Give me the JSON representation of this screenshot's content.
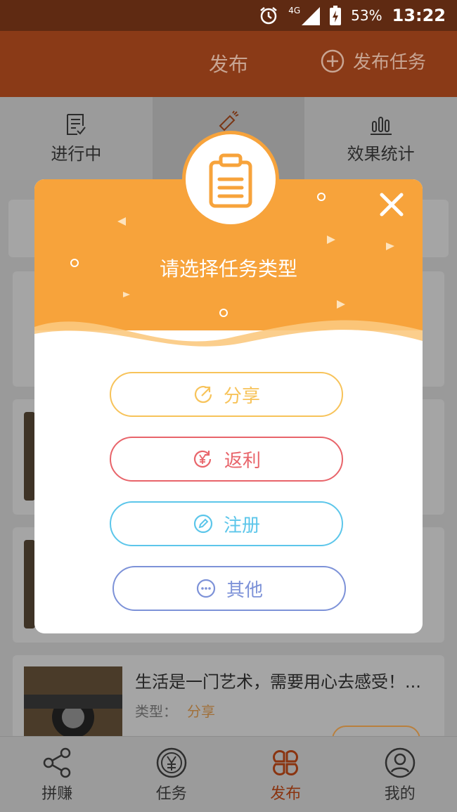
{
  "status": {
    "network": "4G",
    "battery": "53%",
    "time": "13:22"
  },
  "header": {
    "title": "发布",
    "publish_label": "发布任务"
  },
  "tabs": [
    {
      "label": "进行中"
    },
    {
      "label": ""
    },
    {
      "label": "效果统计"
    }
  ],
  "list": {
    "card_title": "生活是一门艺术，需要用心去感受！...",
    "card_type_label": "类型：",
    "card_type_value": "分享"
  },
  "modal": {
    "title": "请选择任务类型",
    "options": [
      {
        "label": "分享",
        "color": "#f7c35a",
        "icon": "share-icon"
      },
      {
        "label": "返利",
        "color": "#e8646a",
        "icon": "rebate-icon"
      },
      {
        "label": "注册",
        "color": "#5cc6ea",
        "icon": "register-icon"
      },
      {
        "label": "其他",
        "color": "#7d92d8",
        "icon": "more-icon"
      }
    ],
    "accent": "#f7a33b"
  },
  "bottom_nav": [
    {
      "label": "拼赚",
      "icon": "share-network-icon"
    },
    {
      "label": "任务",
      "icon": "yuan-coin-icon"
    },
    {
      "label": "发布",
      "icon": "clover-icon",
      "active": true
    },
    {
      "label": "我的",
      "icon": "user-icon"
    }
  ]
}
